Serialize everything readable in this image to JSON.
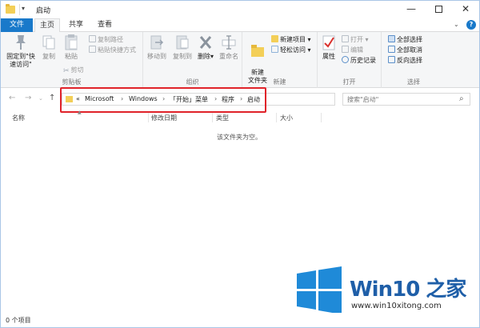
{
  "window": {
    "title": "启动"
  },
  "window_controls": {
    "minimize": "—",
    "maximize": "",
    "close": "✕"
  },
  "tabs": {
    "file": "文件",
    "home": "主页",
    "share": "共享",
    "view": "查看"
  },
  "ribbon": {
    "clipboard": {
      "pin_label": "固定到\"快速访问\"",
      "copy_label": "复制",
      "paste_label": "粘贴",
      "copy_path": "复制路径",
      "paste_shortcut": "粘贴快捷方式",
      "cut": "剪切",
      "group_label": "剪贴板"
    },
    "organize": {
      "move_to": "移动到",
      "copy_to": "复制到",
      "delete": "删除",
      "rename": "重命名",
      "group_label": "组织"
    },
    "new": {
      "new_folder": "新建\n文件夹",
      "new_item": "新建项目",
      "easy_access": "轻松访问",
      "group_label": "新建"
    },
    "open": {
      "properties": "属性",
      "open": "打开",
      "edit": "编辑",
      "history": "历史记录",
      "group_label": "打开"
    },
    "select": {
      "select_all": "全部选择",
      "select_none": "全部取消",
      "invert": "反向选择",
      "group_label": "选择"
    }
  },
  "address": {
    "breadcrumbs": [
      "«",
      "Microsoft",
      "Windows",
      "「开始」菜单",
      "程序",
      "启动"
    ],
    "separator": "›"
  },
  "search": {
    "placeholder": "搜索\"启动\""
  },
  "columns": {
    "name": "名称",
    "modified": "修改日期",
    "type": "类型",
    "size": "大小"
  },
  "content": {
    "empty_message": "该文件夹为空。"
  },
  "status": {
    "item_count": "0 个项目"
  },
  "watermark": {
    "brand": "Win10 之家",
    "url": "www.win10xitong.com"
  },
  "colors": {
    "accent": "#1979ca",
    "highlight": "#e0232a",
    "folder": "#f3cf58",
    "logo": "#1f8ad8"
  }
}
